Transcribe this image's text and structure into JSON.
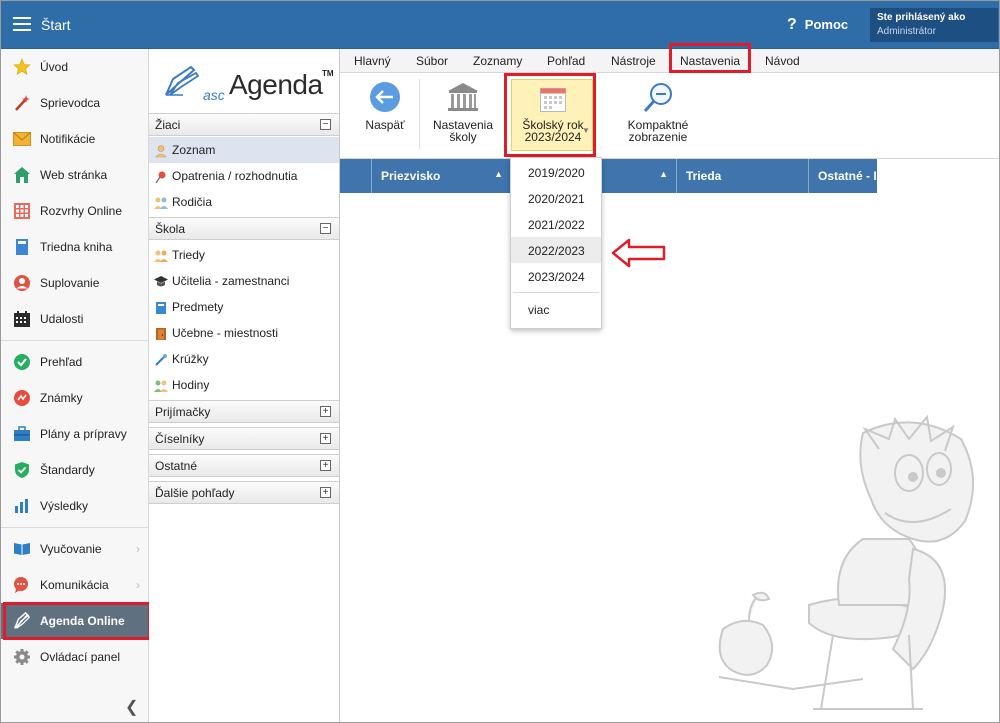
{
  "app": {
    "title": "Štart"
  },
  "header": {
    "help_label": "Pomoc",
    "help_icon": "question-icon",
    "user_line1": "Ste prihlásený ako",
    "user_line2": "Administrátor"
  },
  "leftnav": {
    "items": [
      {
        "label": "Úvod",
        "icon": "star-icon"
      },
      {
        "label": "Sprievodca",
        "icon": "wand-icon"
      },
      {
        "label": "Notifikácie",
        "icon": "envelope-icon"
      },
      {
        "label": "Web stránka",
        "icon": "house-icon"
      },
      {
        "label": "Rozvrhy Online",
        "icon": "timetable-icon"
      },
      {
        "label": "Triedna kniha",
        "icon": "book-icon"
      },
      {
        "label": "Suplovanie",
        "icon": "person-icon"
      },
      {
        "label": "Udalosti",
        "icon": "calendar-icon"
      },
      {
        "label": "Prehľad",
        "icon": "check-circle-icon"
      },
      {
        "label": "Známky",
        "icon": "grade-icon"
      },
      {
        "label": "Plány a prípravy",
        "icon": "briefcase-icon"
      },
      {
        "label": "Štandardy",
        "icon": "shield-check-icon"
      },
      {
        "label": "Výsledky",
        "icon": "bar-chart-icon"
      },
      {
        "label": "Vyučovanie",
        "icon": "open-book-icon"
      },
      {
        "label": "Komunikácia",
        "icon": "chat-icon"
      },
      {
        "label": "Agenda Online",
        "icon": "pen-icon"
      },
      {
        "label": "Ovládací panel",
        "icon": "gear-icon"
      }
    ]
  },
  "agenda": {
    "logo_prefix": "asc",
    "logo_name": "Agenda",
    "logo_tm": "TM",
    "sections": [
      {
        "label": "Žiaci",
        "toggle": "−"
      },
      {
        "label": "Škola",
        "toggle": "−"
      },
      {
        "label": "Prijímačky",
        "toggle": "+"
      },
      {
        "label": "Číselníky",
        "toggle": "+"
      },
      {
        "label": "Ostatné",
        "toggle": "+"
      },
      {
        "label": "Ďalšie pohľady",
        "toggle": "+"
      }
    ],
    "ziaci_items": [
      {
        "label": "Zoznam",
        "icon": "student-icon"
      },
      {
        "label": "Opatrenia / rozhodnutia",
        "icon": "pin-icon"
      },
      {
        "label": "Rodičia",
        "icon": "parents-icon"
      }
    ],
    "skola_items": [
      {
        "label": "Triedy",
        "icon": "class-icon"
      },
      {
        "label": "Učitelia - zamestnanci",
        "icon": "graduation-cap-icon"
      },
      {
        "label": "Predmety",
        "icon": "subject-book-icon"
      },
      {
        "label": "Učebne - miestnosti",
        "icon": "door-icon"
      },
      {
        "label": "Krúžky",
        "icon": "hobby-icon"
      },
      {
        "label": "Hodiny",
        "icon": "lessons-icon"
      }
    ]
  },
  "menu": {
    "tabs": [
      "Hlavný",
      "Súbor",
      "Zoznamy",
      "Pohľad",
      "Nástroje",
      "Nastavenia",
      "Návod"
    ]
  },
  "ribbon": {
    "back": {
      "line1": "Naspäť",
      "icon": "back-arrow-icon"
    },
    "school_settings": {
      "line1": "Nastavenia",
      "line2": "školy",
      "icon": "school-building-icon"
    },
    "school_year": {
      "line1": "Školský rok",
      "line2": "2023/2024",
      "icon": "calendar-icon"
    },
    "compact": {
      "line1": "Kompaktné",
      "line2": "zobrazenie",
      "icon": "magnifier-icon"
    }
  },
  "table": {
    "columns": [
      "Priezvisko",
      "",
      "Trieda",
      "Ostatné - I"
    ]
  },
  "dropdown": {
    "options": [
      "2019/2020",
      "2020/2021",
      "2021/2022",
      "2022/2023",
      "2023/2024"
    ],
    "more_label": "viac"
  }
}
